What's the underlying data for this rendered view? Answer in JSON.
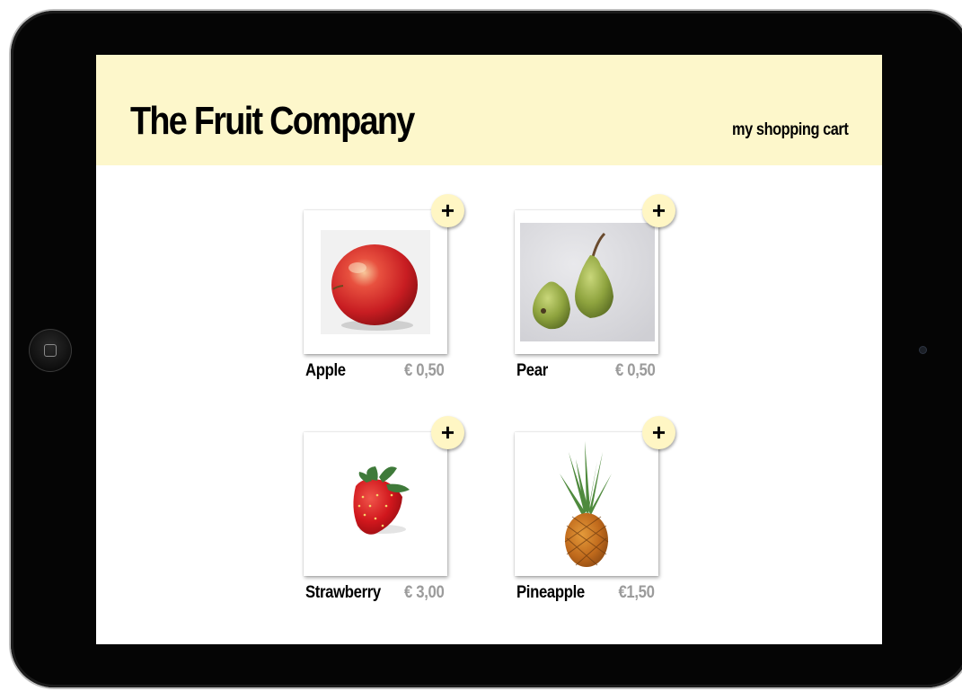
{
  "header": {
    "title": "The Fruit Company",
    "cart_link": "my shopping cart",
    "background_color": "#fdf7cb"
  },
  "products": [
    {
      "name": "Apple",
      "price": "€ 0,50",
      "add_label": "+",
      "image": "apple-photo"
    },
    {
      "name": "Pear",
      "price": "€ 0,50",
      "add_label": "+",
      "image": "pear-photo"
    },
    {
      "name": "Strawberry",
      "price": "€ 3,00",
      "add_label": "+",
      "image": "strawberry-photo"
    },
    {
      "name": "Pineapple",
      "price": "€1,50",
      "add_label": "+",
      "image": "pineapple-photo"
    }
  ],
  "colors": {
    "device_frame": "#050505",
    "add_button": "#fff6c4",
    "price_text": "#9b9b9b"
  }
}
